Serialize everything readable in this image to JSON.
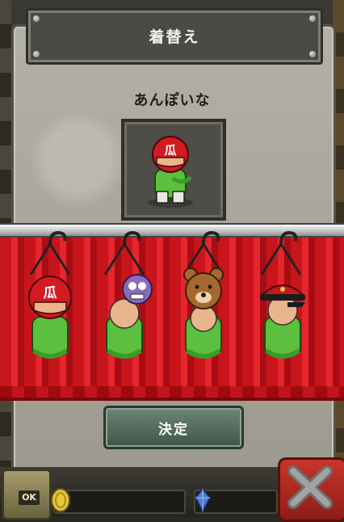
{
  "screen": {
    "title": "着替え",
    "character_name": "あんぽいな",
    "decide_label": "決定"
  },
  "hud": {
    "ok_label": "OK"
  },
  "outfits": [
    {
      "icon": "red-helmet-outfit-icon"
    },
    {
      "icon": "purple-mask-outfit-icon"
    },
    {
      "icon": "bear-head-outfit-icon"
    },
    {
      "icon": "military-cap-outfit-icon"
    }
  ],
  "colors": {
    "curtain": "#d81b22",
    "panel": "#a9a69c",
    "button": "#4e6658",
    "close": "#b72b20"
  }
}
